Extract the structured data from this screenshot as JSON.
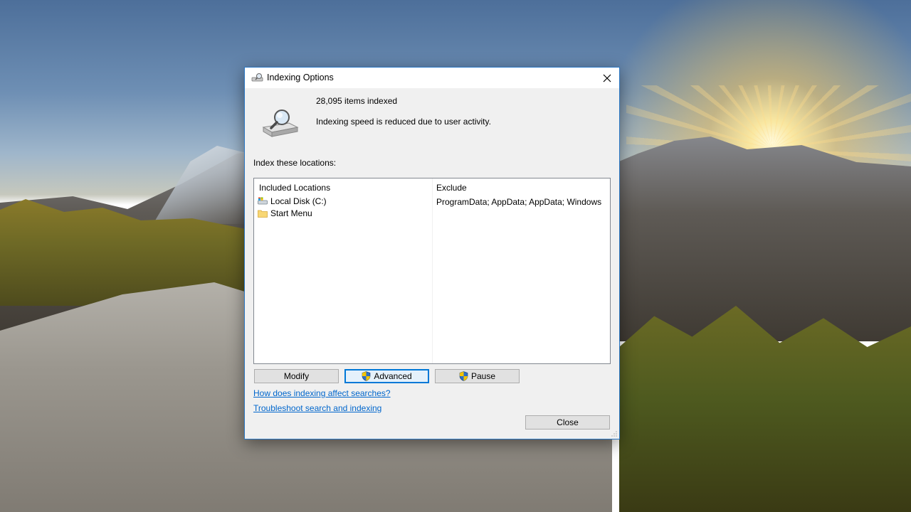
{
  "window": {
    "title": "Indexing Options"
  },
  "status": {
    "items_indexed": "28,095 items indexed",
    "message": "Indexing speed is reduced due to user activity."
  },
  "locations": {
    "section_label": "Index these locations:",
    "columns": [
      "Included Locations",
      "Exclude"
    ],
    "rows": [
      {
        "name": "Local Disk (C:)",
        "exclude": "ProgramData; AppData; AppData; Windows",
        "icon": "local-disk-icon"
      },
      {
        "name": "Start Menu",
        "exclude": "",
        "icon": "folder-icon"
      }
    ]
  },
  "buttons": {
    "modify": "Modify",
    "advanced": "Advanced",
    "pause": "Pause",
    "close": "Close"
  },
  "links": {
    "how_affect": "How does indexing affect searches?",
    "troubleshoot": "Troubleshoot search and indexing"
  },
  "colors": {
    "accent": "#0078d7",
    "window_border": "#2b78c5",
    "link": "#0066cc",
    "dialog_bg": "#f0f0f0"
  }
}
